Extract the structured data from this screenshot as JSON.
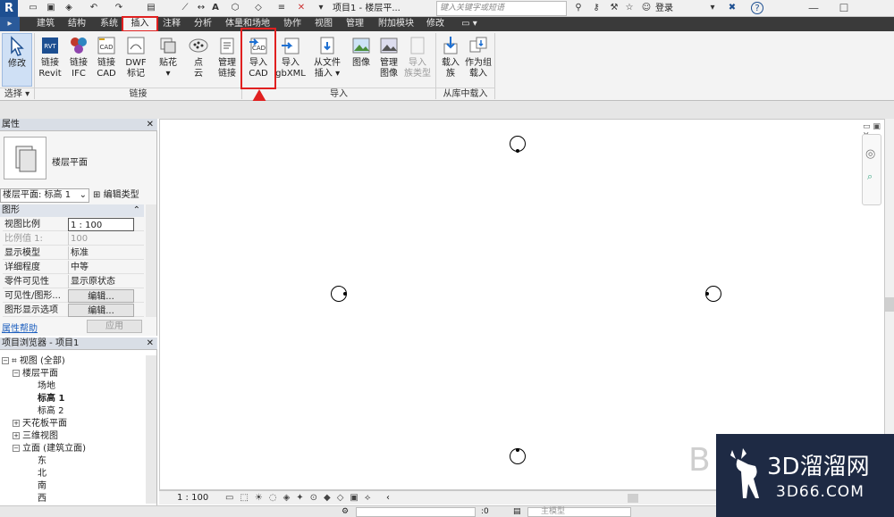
{
  "titlebar": {
    "logo": "R",
    "title": "项目1 - 楼层平...",
    "search_placeholder": "键入关键字或短语",
    "login": "登录",
    "help": "?",
    "minimize": "—",
    "maximize": "☐"
  },
  "menubar": {
    "tabs": [
      "建筑",
      "结构",
      "系统",
      "插入",
      "注释",
      "分析",
      "体量和场地",
      "协作",
      "视图",
      "管理",
      "附加模块",
      "修改"
    ],
    "active": "插入"
  },
  "ribbon": {
    "buttons": [
      {
        "id": "modify",
        "label1": "修改",
        "label2": ""
      },
      {
        "id": "link-revit",
        "label1": "链接",
        "label2": "Revit"
      },
      {
        "id": "link-ifc",
        "label1": "链接",
        "label2": "IFC"
      },
      {
        "id": "link-cad",
        "label1": "链接",
        "label2": "CAD"
      },
      {
        "id": "dwf-markup",
        "label1": "DWF",
        "label2": "标记"
      },
      {
        "id": "decal",
        "label1": "贴花",
        "label2": ""
      },
      {
        "id": "point-cloud",
        "label1": "点",
        "label2": "云"
      },
      {
        "id": "manage-links",
        "label1": "管理",
        "label2": "链接"
      },
      {
        "id": "import-cad",
        "label1": "导入",
        "label2": "CAD"
      },
      {
        "id": "import-gbxml",
        "label1": "导入",
        "label2": "gbXML"
      },
      {
        "id": "from-file-insert",
        "label1": "从文件",
        "label2": "插入"
      },
      {
        "id": "image",
        "label1": "图像",
        "label2": ""
      },
      {
        "id": "manage-images",
        "label1": "管理",
        "label2": "图像"
      },
      {
        "id": "import-family-types",
        "label1": "导入",
        "label2": "族类型"
      },
      {
        "id": "load-family",
        "label1": "载入",
        "label2": "族"
      },
      {
        "id": "load-as-group",
        "label1": "作为组",
        "label2": "载入"
      }
    ],
    "panels": {
      "select": "选择",
      "link": "链接",
      "import": "导入",
      "library": "从库中载入"
    }
  },
  "properties": {
    "header": "属性",
    "type_name": "楼层平面",
    "selector": "楼层平面: 标高 1",
    "edit_type": "编辑类型",
    "group": "图形",
    "rows": [
      {
        "k": "视图比例",
        "v": "1 : 100"
      },
      {
        "k": "比例值 1:",
        "v": "100"
      },
      {
        "k": "显示模型",
        "v": "标准"
      },
      {
        "k": "详细程度",
        "v": "中等"
      },
      {
        "k": "零件可见性",
        "v": "显示原状态"
      },
      {
        "k": "可见性/图形...",
        "v": "编辑..."
      },
      {
        "k": "图形显示选项",
        "v": "编辑..."
      }
    ],
    "help": "属性帮助",
    "apply": "应用"
  },
  "browser": {
    "header": "项目浏览器 - 项目1",
    "items": [
      {
        "label": "视图 (全部)"
      },
      {
        "label": "楼层平面"
      },
      {
        "label": "场地"
      },
      {
        "label": "标高 1"
      },
      {
        "label": "标高 2"
      },
      {
        "label": "天花板平面"
      },
      {
        "label": "三维视图"
      },
      {
        "label": "立面 (建筑立面)"
      },
      {
        "label": "东"
      },
      {
        "label": "北"
      },
      {
        "label": "南"
      },
      {
        "label": "西"
      }
    ]
  },
  "viewbar": {
    "scale": "1 : 100"
  },
  "statusbar": {
    "value": ":0",
    "model": "主模型"
  },
  "watermark": {
    "text": "3D溜溜网",
    "sub": "3D66.COM",
    "ghost": "B"
  },
  "colors": {
    "highlight": "#e02020",
    "menubar": "#3a3a3a",
    "accent": "#1d4f91"
  }
}
